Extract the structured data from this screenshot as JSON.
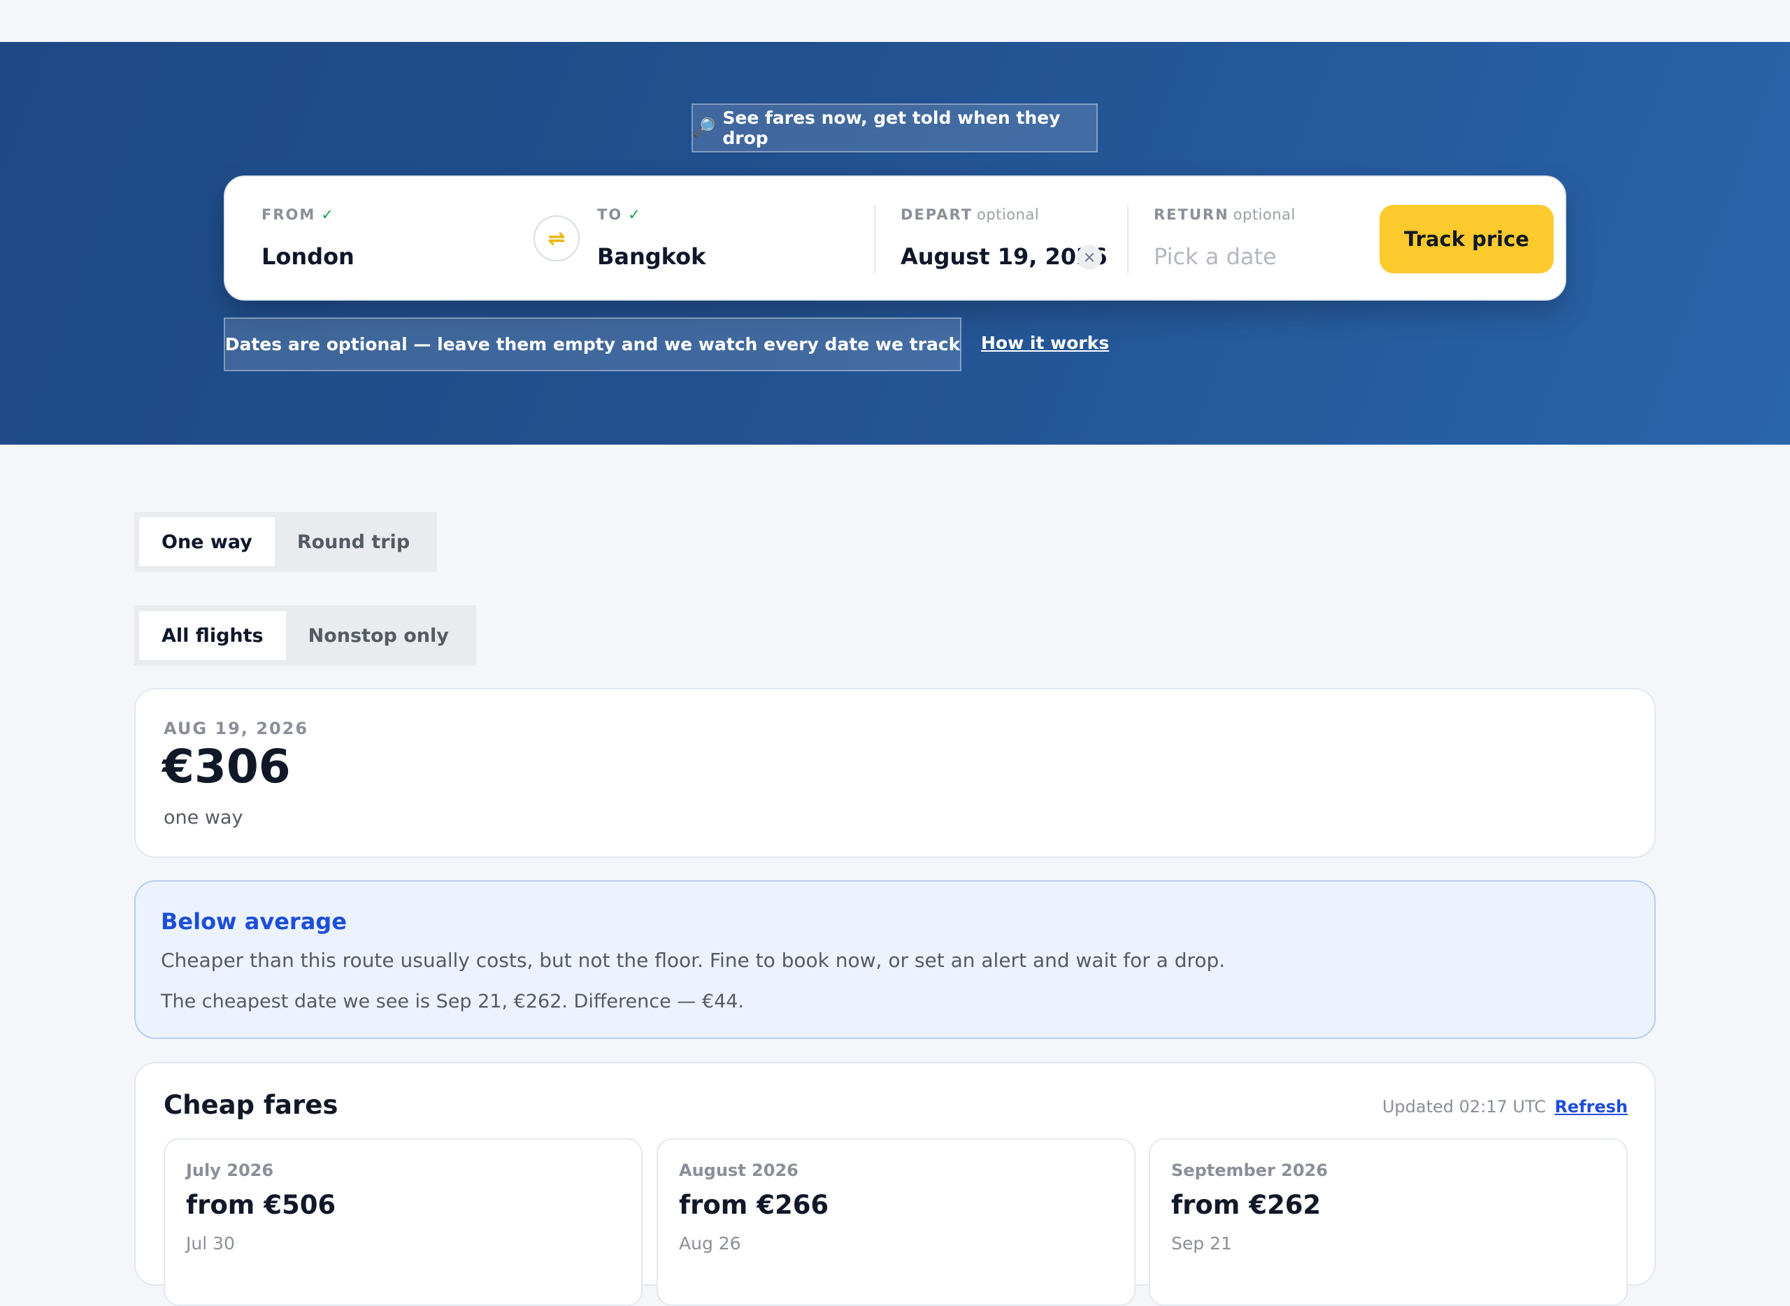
{
  "hero": {
    "promo_icon": "🔎",
    "promo_text": "See fares now, get told when they drop"
  },
  "search": {
    "from": {
      "label": "FROM",
      "check": "✓",
      "value": "London"
    },
    "swap_icon": "⇌",
    "to": {
      "label": "TO",
      "check": "✓",
      "value": "Bangkok"
    },
    "depart": {
      "label": "DEPART",
      "optional": "optional",
      "value": "August 19, 2026",
      "clear": "×"
    },
    "return": {
      "label": "RETURN",
      "optional": "optional",
      "placeholder": "Pick a date"
    },
    "track_button": "Track price"
  },
  "note": {
    "text": "Dates are optional — leave them empty and we watch every date we track",
    "link": "How it works"
  },
  "trip_toggle": {
    "options": [
      "One way",
      "Round trip"
    ],
    "selected": "One way"
  },
  "stops_toggle": {
    "options": [
      "All flights",
      "Nonstop only"
    ],
    "selected": "All flights"
  },
  "price_card": {
    "date": "AUG 19, 2026",
    "price": "€306",
    "type": "one way"
  },
  "insight": {
    "title": "Below average",
    "body": "Cheaper than this route usually costs, but not the floor. Fine to book now, or set an alert and wait for a drop.",
    "detail": "The cheapest date we see is Sep 21, €262. Difference — €44."
  },
  "cheap_fares": {
    "title": "Cheap fares",
    "updated": "Updated 02:17 UTC",
    "refresh": "Refresh",
    "months": [
      {
        "month": "July 2026",
        "price": "from €506",
        "date": "Jul 30"
      },
      {
        "month": "August 2026",
        "price": "from €266",
        "date": "Aug 26"
      },
      {
        "month": "September 2026",
        "price": "from €262",
        "date": "Sep 21"
      }
    ]
  },
  "colors": {
    "hero_bg": "#22518f",
    "accent_yellow": "#fcca2d",
    "link_blue": "#1d4ed8",
    "insight_bg": "#ecf3ff",
    "check_green": "#16a34a"
  }
}
